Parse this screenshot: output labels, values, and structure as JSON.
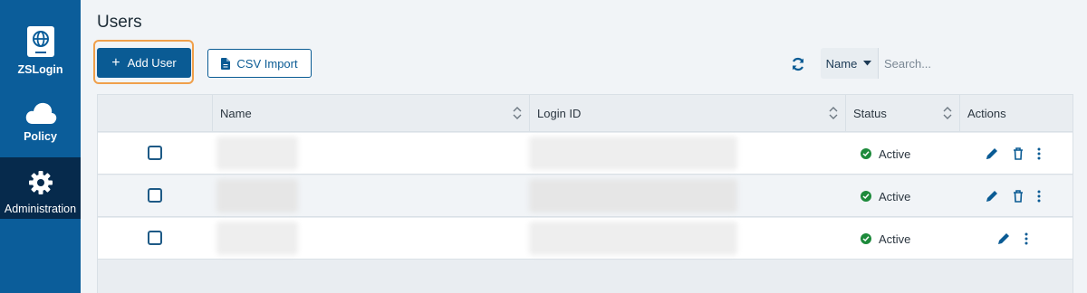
{
  "sidebar": {
    "items": [
      {
        "label": "ZSLogin",
        "icon": "globe-badge-icon"
      },
      {
        "label": "Policy",
        "icon": "cloud-icon"
      },
      {
        "label": "Administration",
        "icon": "gear-icon",
        "active": true
      }
    ]
  },
  "page": {
    "title": "Users"
  },
  "toolbar": {
    "add_user_label": "Add User",
    "csv_import_label": "CSV Import",
    "refresh_icon": "refresh-icon"
  },
  "search": {
    "field_select": "Name",
    "placeholder": "Search..."
  },
  "table": {
    "columns": [
      "Name",
      "Login ID",
      "Status",
      "Actions"
    ],
    "rows": [
      {
        "name": "",
        "login_id": "",
        "status": "Active",
        "actions": [
          "edit",
          "delete",
          "more"
        ]
      },
      {
        "name": "",
        "login_id": "",
        "status": "Active",
        "actions": [
          "edit",
          "delete",
          "more"
        ]
      },
      {
        "name": "",
        "login_id": "",
        "status": "Active",
        "actions": [
          "edit",
          "more"
        ]
      }
    ]
  },
  "colors": {
    "sidebar_bg": "#0b5d9a",
    "sidebar_active": "#062a4c",
    "primary": "#0a5b94",
    "highlight": "#f0a04b",
    "status_active": "#1d8a3b"
  }
}
